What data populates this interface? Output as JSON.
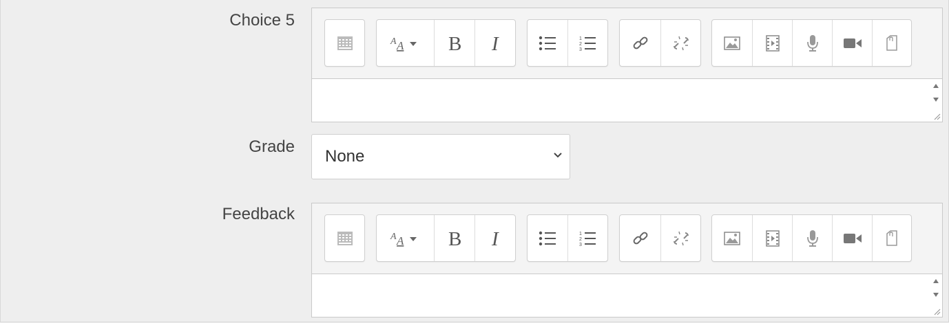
{
  "fields": {
    "choice": {
      "label": "Choice 5",
      "value": ""
    },
    "grade": {
      "label": "Grade",
      "selected": "None"
    },
    "feedback": {
      "label": "Feedback",
      "value": ""
    }
  },
  "toolbar": {
    "groups": [
      [
        "toggle-toolbar-icon"
      ],
      [
        "font-style-icon",
        "bold-icon",
        "italic-icon"
      ],
      [
        "unordered-list-icon",
        "ordered-list-icon"
      ],
      [
        "link-icon",
        "unlink-icon"
      ],
      [
        "image-icon",
        "media-icon",
        "record-audio-icon",
        "record-video-icon",
        "manage-files-icon"
      ]
    ]
  },
  "colors": {
    "background": "#eeeeee",
    "border": "#c9c9c9",
    "icon": "#777777"
  }
}
